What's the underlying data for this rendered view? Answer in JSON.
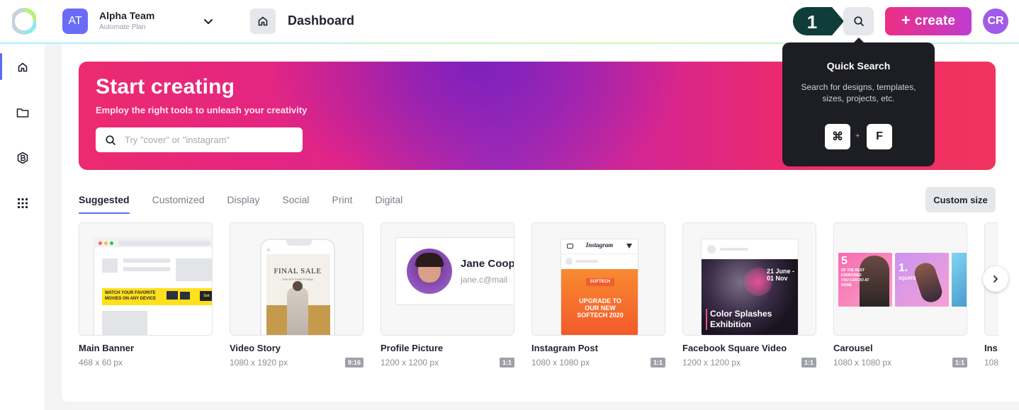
{
  "header": {
    "team_initials": "AT",
    "team_name": "Alpha Team",
    "team_plan": "Automate Plan",
    "page_title": "Dashboard",
    "step_number": "1",
    "create_label": "create",
    "user_initials": "CR"
  },
  "hero": {
    "title": "Start creating",
    "subtitle": "Employ the right tools to unleash your creativity",
    "search_placeholder": "Try \"cover\" or \"instagram\""
  },
  "tooltip": {
    "title": "Quick Search",
    "description": "Search for designs, templates, sizes, projects, etc.",
    "key_modifier": "⌘",
    "key_plus": "+",
    "key_letter": "F"
  },
  "tabs": [
    "Suggested",
    "Customized",
    "Display",
    "Social",
    "Print",
    "Digital"
  ],
  "custom_size_label": "Custom size",
  "cards": [
    {
      "title": "Main Banner",
      "size": "468 x 60 px",
      "ratio": ""
    },
    {
      "title": "Video Story",
      "size": "1080 x 1920 px",
      "ratio": "9:16"
    },
    {
      "title": "Profile Picture",
      "size": "1200 x 1200 px",
      "ratio": "1:1"
    },
    {
      "title": "Instagram Post",
      "size": "1080 x 1080 px",
      "ratio": "1:1"
    },
    {
      "title": "Facebook Square Video",
      "size": "1200 x 1200 px",
      "ratio": "1:1"
    },
    {
      "title": "Carousel",
      "size": "1080 x 1080 px",
      "ratio": "1:1"
    },
    {
      "title": "Ins",
      "size": "108",
      "ratio": ""
    }
  ],
  "thumbs": {
    "banner_text": "WATCH YOUR FAVORITE MOVIES ON ANY DEVICE",
    "banner_cta": "Get",
    "story_title": "FINAL SALE",
    "story_sub": "70% OFF EVERYTHING",
    "profile_name": "Jane Coop",
    "profile_email": "jane.c@mail",
    "insta_brand": "Instagram",
    "insta_company": "SOFTECH",
    "insta_headline": "UPGRADE TO OUR NEW SOFTECH 2020",
    "fb_date": "21 June - 01 Nov",
    "fb_headline": "Color Splashes Exhibition",
    "carousel_number": "5",
    "carousel_text": "OF THE BEST EXERCISES YOU CAN DO AT HOME",
    "carousel_number2": "1.",
    "carousel_text2": "SQUATS"
  },
  "colors": {
    "accent": "#5b6cf0",
    "create_start": "#ec2f83",
    "create_end": "#c13bd0",
    "team_avatar": "#6b6cf6",
    "user_avatar": "#a25ae8",
    "tooltip_bg": "#1d1e23"
  }
}
